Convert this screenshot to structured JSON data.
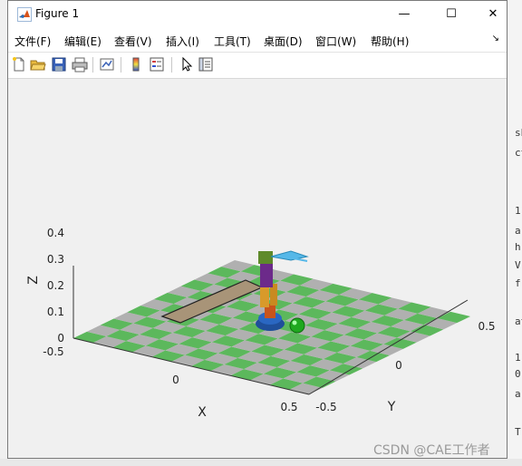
{
  "window": {
    "title": "Figure 1",
    "minimize_glyph": "—",
    "maximize_glyph": "☐",
    "close_glyph": "✕"
  },
  "menu": {
    "items": [
      "文件(F)",
      "编辑(E)",
      "查看(V)",
      "插入(I)",
      "工具(T)",
      "桌面(D)",
      "窗口(W)",
      "帮助(H)"
    ],
    "overflow_glyph": "↘"
  },
  "toolbar": {
    "icons": [
      "new-figure-icon",
      "open-file-icon",
      "save-icon",
      "print-icon",
      "link-plot-icon",
      "colorbar-icon",
      "legend-icon",
      "pointer-icon",
      "property-inspector-icon"
    ]
  },
  "axes": {
    "z_label": "Z",
    "x_label": "X",
    "y_label": "Y",
    "z_ticks": [
      "0",
      "0.1",
      "0.2",
      "0.3",
      "0.4"
    ],
    "x_ticks": [
      "-0.5",
      "0",
      "0.5"
    ],
    "y_ticks": [
      "-0.5",
      "0",
      "0.5"
    ],
    "grid": true,
    "floor_colors": [
      "#5cb85c",
      "#b0b0b0"
    ]
  },
  "right_strip": [
    "sh",
    "ct",
    "1",
    "a",
    "h",
    "V",
    "f",
    "at",
    "1",
    "0",
    "a",
    "T"
  ],
  "watermark": "CSDN @CAE工作者"
}
